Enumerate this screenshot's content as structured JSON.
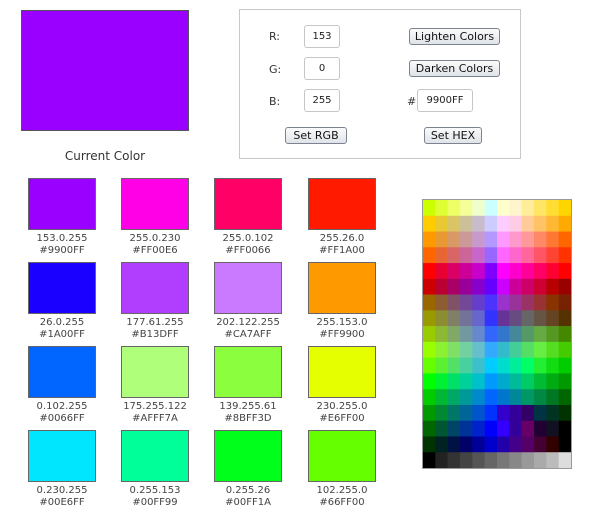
{
  "current": {
    "color": "#9900FF",
    "label": "Current Color"
  },
  "controls": {
    "r_label": "R:",
    "g_label": "G:",
    "b_label": "B:",
    "r_value": "153",
    "g_value": "0",
    "b_value": "255",
    "hash_label": "#",
    "hex_value": "9900FF",
    "lighten_label": "Lighten Colors",
    "darken_label": "Darken Colors",
    "set_rgb_label": "Set RGB",
    "set_hex_label": "Set HEX"
  },
  "swatches": [
    {
      "rgb": "153.0.255",
      "hex": "#9900FF"
    },
    {
      "rgb": "255.0.230",
      "hex": "#FF00E6"
    },
    {
      "rgb": "255.0.102",
      "hex": "#FF0066"
    },
    {
      "rgb": "255.26.0",
      "hex": "#FF1A00"
    },
    {
      "rgb": "26.0.255",
      "hex": "#1A00FF"
    },
    {
      "rgb": "177.61.255",
      "hex": "#B13DFF"
    },
    {
      "rgb": "202.122.255",
      "hex": "#CA7AFF"
    },
    {
      "rgb": "255.153.0",
      "hex": "#FF9900"
    },
    {
      "rgb": "0.102.255",
      "hex": "#0066FF"
    },
    {
      "rgb": "175.255.122",
      "hex": "#AFFF7A"
    },
    {
      "rgb": "139.255.61",
      "hex": "#8BFF3D"
    },
    {
      "rgb": "230.255.0",
      "hex": "#E6FF00"
    },
    {
      "rgb": "0.230.255",
      "hex": "#00E6FF"
    },
    {
      "rgb": "0.255.153",
      "hex": "#00FF99"
    },
    {
      "rgb": "0.255.26",
      "hex": "#00FF1A"
    },
    {
      "rgb": "102.255.0",
      "hex": "#66FF00"
    }
  ],
  "palette": [
    [
      "#CCFF00",
      "#DDFF33",
      "#EEFF66",
      "#F5FF99",
      "#EEFFCC",
      "#CCFFFF",
      "#FFFFCC",
      "#FFF5CC",
      "#FFEE99",
      "#FFE566",
      "#FFDD33",
      "#FFD500"
    ],
    [
      "#FFCC00",
      "#E8C833",
      "#D9C466",
      "#CCC099",
      "#C8BCCC",
      "#CCCCFF",
      "#FFCCFF",
      "#FFCCE6",
      "#FFCC99",
      "#FFC266",
      "#FFB833",
      "#FFAA00"
    ],
    [
      "#FF9900",
      "#E89933",
      "#D99966",
      "#CC9999",
      "#C899CC",
      "#B399FF",
      "#FF99FF",
      "#FF99CC",
      "#FF9999",
      "#FF8866",
      "#FF7733",
      "#FF6600"
    ],
    [
      "#FF6600",
      "#E86633",
      "#D96666",
      "#CC6699",
      "#C866CC",
      "#9966FF",
      "#FF66FF",
      "#FF66CC",
      "#FF6699",
      "#FF5566",
      "#FF4433",
      "#FF3300"
    ],
    [
      "#FF0000",
      "#E80033",
      "#D90066",
      "#CC0099",
      "#C800CC",
      "#8000FF",
      "#FF00FF",
      "#FF00CC",
      "#FF0099",
      "#FF0066",
      "#FF0033",
      "#FF0000"
    ],
    [
      "#CC0000",
      "#B80033",
      "#A80066",
      "#990099",
      "#8800CC",
      "#6600FF",
      "#CC00FF",
      "#CC0099",
      "#CC0066",
      "#CC0033",
      "#B80000",
      "#990000"
    ],
    [
      "#996600",
      "#8C5C33",
      "#805266",
      "#734899",
      "#663ECC",
      "#4D33FF",
      "#9933CC",
      "#993399",
      "#993366",
      "#993333",
      "#883300",
      "#772200"
    ],
    [
      "#999900",
      "#8C8C33",
      "#808066",
      "#737399",
      "#6666CC",
      "#3333FF",
      "#663399",
      "#664C80",
      "#666666",
      "#665544",
      "#664422",
      "#553300"
    ],
    [
      "#99CC00",
      "#8CB833",
      "#80A866",
      "#7399A0",
      "#6688CC",
      "#3366FF",
      "#3377CC",
      "#448899",
      "#559966",
      "#66AA44",
      "#559922",
      "#448800"
    ],
    [
      "#99FF00",
      "#8CF033",
      "#80E066",
      "#73D0A0",
      "#66C0CC",
      "#33AAFF",
      "#33BBCC",
      "#44CC99",
      "#55DD66",
      "#66EE44",
      "#55DD22",
      "#44CC00"
    ],
    [
      "#66FF00",
      "#5CF033",
      "#52E066",
      "#48D0A0",
      "#3EC0CC",
      "#00CCFF",
      "#00DDCC",
      "#00EE99",
      "#00FF66",
      "#22EE33",
      "#11DD11",
      "#00CC00"
    ],
    [
      "#00FF00",
      "#00F033",
      "#00E066",
      "#00D099",
      "#00C0CC",
      "#0099FF",
      "#00AACC",
      "#00BB99",
      "#00CC66",
      "#00BB33",
      "#00AA11",
      "#009900"
    ],
    [
      "#00CC00",
      "#00B833",
      "#00A866",
      "#009999",
      "#0088CC",
      "#0066FF",
      "#0077CC",
      "#008899",
      "#009966",
      "#008844",
      "#007722",
      "#006600"
    ],
    [
      "#009900",
      "#008833",
      "#007766",
      "#006699",
      "#0055CC",
      "#0033FF",
      "#3300CC",
      "#330099",
      "#330066",
      "#003344",
      "#003322",
      "#003300"
    ],
    [
      "#006600",
      "#005533",
      "#004466",
      "#003399",
      "#0022CC",
      "#0000FF",
      "#3300FF",
      "#330099",
      "#660066",
      "#220033",
      "#111122",
      "#000000"
    ],
    [
      "#003300",
      "#002222",
      "#001144",
      "#000066",
      "#000099",
      "#0000CC",
      "#2200AA",
      "#440088",
      "#550066",
      "#440033",
      "#330000",
      "#000000"
    ],
    [
      "#000000",
      "#222222",
      "#333333",
      "#444444",
      "#555555",
      "#666666",
      "#777777",
      "#888888",
      "#999999",
      "#AAAAAA",
      "#BBBBBB",
      "#DDDDDD"
    ]
  ]
}
